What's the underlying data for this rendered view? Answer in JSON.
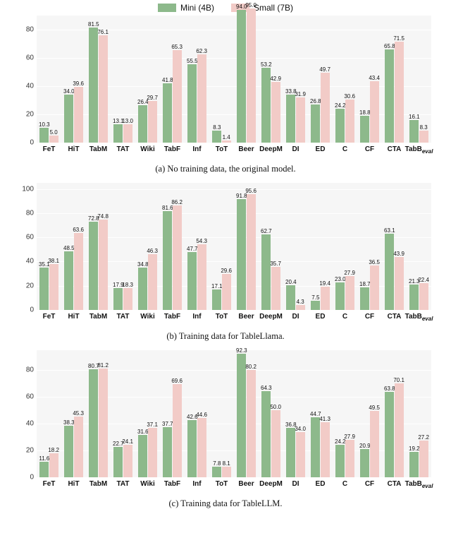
{
  "legend": {
    "series": [
      {
        "key": "mini",
        "label": "Mini (4B)",
        "color": "#8db98b"
      },
      {
        "key": "small",
        "label": "Small (7B)",
        "color": "#f2cbc7"
      }
    ]
  },
  "categories": [
    "FeT",
    "HiT",
    "TabM",
    "TAT",
    "Wiki",
    "TabF",
    "Inf",
    "ToT",
    "Beer",
    "DeepM",
    "DI",
    "ED",
    "C",
    "CF",
    "CTA",
    "TabB_eval"
  ],
  "panels": [
    {
      "id": "a",
      "caption": "(a) No training data, the original model.",
      "ylim": [
        0,
        90
      ],
      "yticks": [
        0,
        20,
        40,
        60,
        80
      ]
    },
    {
      "id": "b",
      "caption": "(b) Training data for TableLlama.",
      "ylim": [
        0,
        105
      ],
      "yticks": [
        0,
        20,
        40,
        60,
        80,
        100
      ]
    },
    {
      "id": "c",
      "caption": "(c) Training data for TableLLM.",
      "ylim": [
        0,
        95
      ],
      "yticks": [
        0,
        20,
        40,
        60,
        80
      ]
    }
  ],
  "chart_data": [
    {
      "type": "bar",
      "panel": "a",
      "categories": [
        "FeT",
        "HiT",
        "TabM",
        "TAT",
        "Wiki",
        "TabF",
        "Inf",
        "ToT",
        "Beer",
        "DeepM",
        "DI",
        "ED",
        "C",
        "CF",
        "CTA",
        "TabB_eval"
      ],
      "series": [
        {
          "name": "Mini (4B)",
          "key": "mini",
          "values": [
            10.3,
            34.0,
            81.5,
            13.1,
            26.4,
            41.8,
            55.5,
            8.3,
            94.0,
            53.2,
            33.8,
            26.8,
            24.2,
            18.8,
            65.8,
            16.1
          ]
        },
        {
          "name": "Small (7B)",
          "key": "small",
          "values": [
            5.0,
            39.6,
            76.1,
            13.0,
            29.7,
            65.3,
            62.3,
            1.4,
            95.0,
            42.9,
            31.9,
            49.7,
            30.6,
            43.4,
            71.5,
            8.3
          ]
        }
      ],
      "title": "(a) No training data, the original model.",
      "ylim": [
        0,
        90
      ],
      "xlabel": "",
      "ylabel": ""
    },
    {
      "type": "bar",
      "panel": "b",
      "categories": [
        "FeT",
        "HiT",
        "TabM",
        "TAT",
        "Wiki",
        "TabF",
        "Inf",
        "ToT",
        "Beer",
        "DeepM",
        "DI",
        "ED",
        "C",
        "CF",
        "CTA",
        "TabB_eval"
      ],
      "series": [
        {
          "name": "Mini (4B)",
          "key": "mini",
          "values": [
            35.1,
            48.5,
            72.8,
            17.9,
            34.8,
            81.6,
            47.7,
            17.1,
            91.8,
            62.7,
            20.4,
            7.5,
            23.0,
            18.7,
            63.1,
            21.3
          ]
        },
        {
          "name": "Small (7B)",
          "key": "small",
          "values": [
            38.1,
            63.6,
            74.8,
            18.3,
            46.3,
            86.2,
            54.3,
            29.6,
            95.6,
            35.7,
            4.3,
            19.4,
            27.9,
            36.5,
            43.9,
            22.4
          ]
        }
      ],
      "title": "(b) Training data for TableLlama.",
      "ylim": [
        0,
        105
      ],
      "xlabel": "",
      "ylabel": ""
    },
    {
      "type": "bar",
      "panel": "c",
      "categories": [
        "FeT",
        "HiT",
        "TabM",
        "TAT",
        "Wiki",
        "TabF",
        "Inf",
        "ToT",
        "Beer",
        "DeepM",
        "DI",
        "ED",
        "C",
        "CF",
        "CTA",
        "TabB_eval"
      ],
      "series": [
        {
          "name": "Mini (4B)",
          "key": "mini",
          "values": [
            11.6,
            38.3,
            80.7,
            22.7,
            31.6,
            37.7,
            42.6,
            7.8,
            92.3,
            64.3,
            36.8,
            44.7,
            24.2,
            20.9,
            63.8,
            19.2
          ]
        },
        {
          "name": "Small (7B)",
          "key": "small",
          "values": [
            18.2,
            45.3,
            81.2,
            24.1,
            37.1,
            69.6,
            44.6,
            8.1,
            80.2,
            50.0,
            34.0,
            41.3,
            27.9,
            49.5,
            70.1,
            27.2
          ]
        }
      ],
      "title": "(c) Training data for TableLLM.",
      "ylim": [
        0,
        95
      ],
      "xlabel": "",
      "ylabel": ""
    }
  ]
}
